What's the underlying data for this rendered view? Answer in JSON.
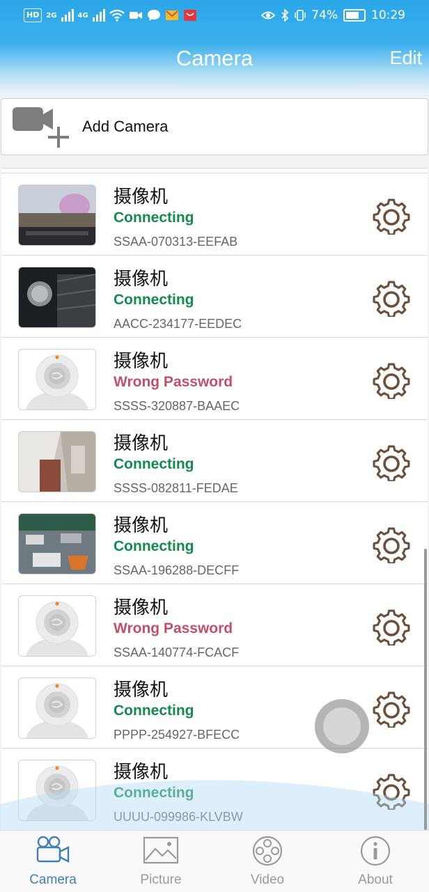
{
  "status_bar": {
    "left_chip_1": "HD",
    "network_1": "2G",
    "network_2": "4G",
    "battery_percent": "74%",
    "time": "10:29"
  },
  "header": {
    "title": "Camera",
    "edit_label": "Edit"
  },
  "add_camera": {
    "label": "Add Camera"
  },
  "cameras": [
    {
      "name": "摄像机",
      "status": "Connecting",
      "status_color": "#138a4e",
      "id": "SSAA-070313-EEFAB",
      "thumbnail": "snapshot"
    },
    {
      "name": "摄像机",
      "status": "Connecting",
      "status_color": "#138a4e",
      "id": "AACC-234177-EEDEC",
      "thumbnail": "snapshot"
    },
    {
      "name": "摄像机",
      "status": "Wrong Password",
      "status_color": "#c2506a",
      "id": "SSSS-320887-BAAEC",
      "thumbnail": "placeholder"
    },
    {
      "name": "摄像机",
      "status": "Connecting",
      "status_color": "#138a4e",
      "id": "SSSS-082811-FEDAE",
      "thumbnail": "snapshot"
    },
    {
      "name": "摄像机",
      "status": "Connecting",
      "status_color": "#138a4e",
      "id": "SSAA-196288-DECFF",
      "thumbnail": "snapshot"
    },
    {
      "name": "摄像机",
      "status": "Wrong Password",
      "status_color": "#c2506a",
      "id": "SSAA-140774-FCACF",
      "thumbnail": "placeholder"
    },
    {
      "name": "摄像机",
      "status": "Connecting",
      "status_color": "#138a4e",
      "id": "PPPP-254927-BFECC",
      "thumbnail": "placeholder"
    },
    {
      "name": "摄像机",
      "status": "Connecting",
      "status_color": "#138a4e",
      "id": "UUUU-099986-KLVBW",
      "thumbnail": "placeholder"
    }
  ],
  "tabs": [
    {
      "label": "Camera",
      "icon": "video-camera-icon",
      "active": true
    },
    {
      "label": "Picture",
      "icon": "picture-icon",
      "active": false
    },
    {
      "label": "Video",
      "icon": "film-reel-icon",
      "active": false
    },
    {
      "label": "About",
      "icon": "info-icon",
      "active": false
    }
  ],
  "colors": {
    "accent": "#2aa6e8",
    "tab_active": "#3f7fb5",
    "tab_inactive": "#9a9a9a",
    "gear": "#6b4f3a"
  }
}
